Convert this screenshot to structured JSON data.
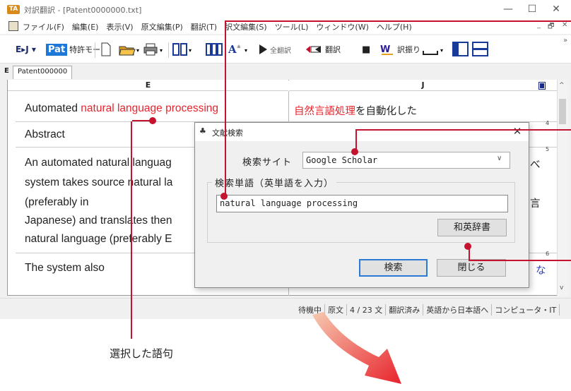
{
  "window": {
    "app_icon": "TA",
    "title": "対訳翻訳 - [Patent0000000.txt]",
    "minimize": "—",
    "maximize": "☐",
    "close": "✕"
  },
  "menu": {
    "items": [
      "ファイル(F)",
      "編集(E)",
      "表示(V)",
      "原文編集(P)",
      "翻訳(T)",
      "訳文編集(S)",
      "ツール(L)",
      "ウィンドウ(W)",
      "ヘルプ(H)"
    ],
    "mdi_min": "_",
    "mdi_restore": "🗗",
    "mdi_close": "✕",
    "overflow": "»"
  },
  "toolbar": {
    "lang_dir": "E▸J ▾",
    "patent_mode": "Pat 特許モード",
    "translate_all": "全翻訳",
    "translate": "翻訳",
    "stop": "■",
    "assign": "訳振り"
  },
  "tabs": {
    "row_label": "E",
    "active_tab": "Patent000000"
  },
  "document": {
    "col_e": "E",
    "col_j": "J",
    "rows": [
      {
        "source_pre": "Automated ",
        "source_highlight": "natural language processing",
        "target_highlight": "自然言語処理",
        "target_post": "を自動化した"
      },
      {
        "source": "Abstract"
      },
      {
        "source_lines": [
          "An automated natural languag",
          "system takes source natural la",
          "(preferably in",
          "Japanese) and translates then",
          "natural language (preferably E"
        ],
        "target_fragments": [
          "べ",
          "言"
        ]
      },
      {
        "source": "The system also",
        "target_fragment": "な"
      }
    ],
    "ruler_numbers": [
      "4",
      "5",
      "6"
    ]
  },
  "status": [
    "待機中",
    "原文",
    "4 / 23 文",
    "翻訳済み",
    "英語から日本語へ",
    "コンピュータ・IT"
  ],
  "dialog": {
    "title": "文献検索",
    "close": "✕",
    "site_label": "検索サイト",
    "site_value": "Google Scholar",
    "group_label": "検索単語（英単語を入力）",
    "search_value": "natural language processing",
    "dict_button": "和英辞書",
    "search_button": "検索",
    "close_button": "閉じる"
  },
  "annotation": {
    "caption": "選択した語句"
  },
  "colors": {
    "highlight_red": "#e8232c",
    "callout": "#c4122f",
    "arrow_start": "#f6c9b0",
    "arrow_end": "#e8232c",
    "default_button_border": "#2b7bd6"
  }
}
